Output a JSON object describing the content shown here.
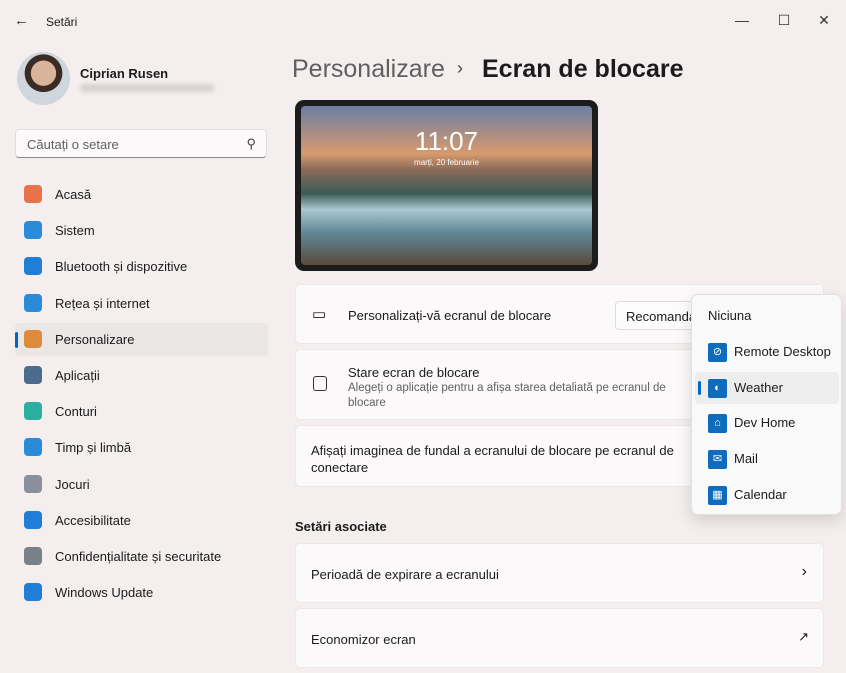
{
  "window": {
    "title": "Setări"
  },
  "user": {
    "name": "Ciprian Rusen"
  },
  "search": {
    "placeholder": "Căutați o setare"
  },
  "sidebar": {
    "items": [
      {
        "label": "Acasă",
        "icon": "home-icon",
        "color": "#e8734a"
      },
      {
        "label": "Sistem",
        "icon": "system-icon",
        "color": "#2a8bd8"
      },
      {
        "label": "Bluetooth și dispozitive",
        "icon": "bluetooth-icon",
        "color": "#1f7fd6"
      },
      {
        "label": "Rețea și internet",
        "icon": "wifi-icon",
        "color": "#2a8bd8"
      },
      {
        "label": "Personalizare",
        "icon": "brush-icon",
        "color": "#e08a3c",
        "selected": true
      },
      {
        "label": "Aplicații",
        "icon": "apps-icon",
        "color": "#4a6b8c"
      },
      {
        "label": "Conturi",
        "icon": "account-icon",
        "color": "#2bb0a0"
      },
      {
        "label": "Timp și limbă",
        "icon": "globe-clock-icon",
        "color": "#2a8bd8"
      },
      {
        "label": "Jocuri",
        "icon": "gamepad-icon",
        "color": "#8a8f99"
      },
      {
        "label": "Accesibilitate",
        "icon": "accessibility-icon",
        "color": "#1f7fd6"
      },
      {
        "label": "Confidențialitate și securitate",
        "icon": "shield-icon",
        "color": "#7a8088"
      },
      {
        "label": "Windows Update",
        "icon": "update-icon",
        "color": "#1f7fd6"
      }
    ]
  },
  "breadcrumb": {
    "parent": "Personalizare",
    "current": "Ecran de blocare"
  },
  "preview": {
    "time": "11:07",
    "date": "marți, 20 februarie"
  },
  "settings": {
    "personalize": {
      "label": "Personalizați-vă ecranul de blocare",
      "value": "Recomandat"
    },
    "status": {
      "label": "Stare ecran de blocare",
      "description": "Alegeți o aplicație pentru a afișa starea detaliată pe ecranul de blocare"
    },
    "signin_bg": {
      "label": "Afișați imaginea de fundal a ecranului de blocare pe ecranul de conectare"
    }
  },
  "related": {
    "title": "Setări asociate",
    "items": [
      {
        "label": "Perioadă de expirare a ecranului"
      },
      {
        "label": "Economizor ecran"
      }
    ]
  },
  "dropdown": {
    "items": [
      {
        "label": "Niciuna"
      },
      {
        "label": "Remote Desktop",
        "icon": "remote-desktop-icon"
      },
      {
        "label": "Weather",
        "icon": "weather-icon",
        "selected": true
      },
      {
        "label": "Dev Home",
        "icon": "dev-home-icon"
      },
      {
        "label": "Mail",
        "icon": "mail-icon"
      },
      {
        "label": "Calendar",
        "icon": "calendar-icon"
      }
    ]
  }
}
